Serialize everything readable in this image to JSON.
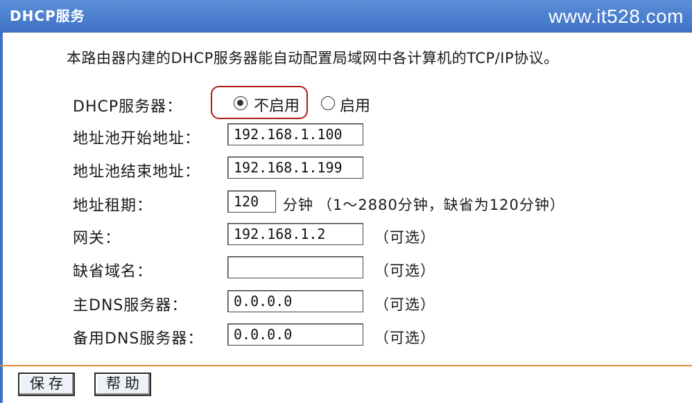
{
  "header": {
    "title": "DHCP服务",
    "watermark": "www.it528.com"
  },
  "intro": "本路由器内建的DHCP服务器能自动配置局域网中各计算机的TCP/IP协议。",
  "dhcp_server": {
    "label": "DHCP服务器：",
    "options": [
      "不启用",
      "启用"
    ],
    "selected": "不启用"
  },
  "fields": {
    "pool_start": {
      "label": "地址池开始地址：",
      "value": "192.168.1.100"
    },
    "pool_end": {
      "label": "地址池结束地址：",
      "value": "192.168.1.199"
    },
    "lease": {
      "label": "地址租期：",
      "value": "120",
      "unit": "分钟",
      "hint": "（1～2880分钟，缺省为120分钟）"
    },
    "gateway": {
      "label": "网关：",
      "value": "192.168.1.2",
      "note": "（可选）"
    },
    "domain": {
      "label": "缺省域名：",
      "value": "",
      "note": "（可选）"
    },
    "primary_dns": {
      "label": "主DNS服务器：",
      "value": "0.0.0.0",
      "note": "（可选）"
    },
    "secondary_dns": {
      "label": "备用DNS服务器：",
      "value": "0.0.0.0",
      "note": "（可选）"
    }
  },
  "buttons": {
    "save": "保存",
    "help": "帮助"
  },
  "colors": {
    "header_bg": "#4a80d0",
    "highlight_border": "#b01818",
    "divider": "#e08a3a"
  }
}
